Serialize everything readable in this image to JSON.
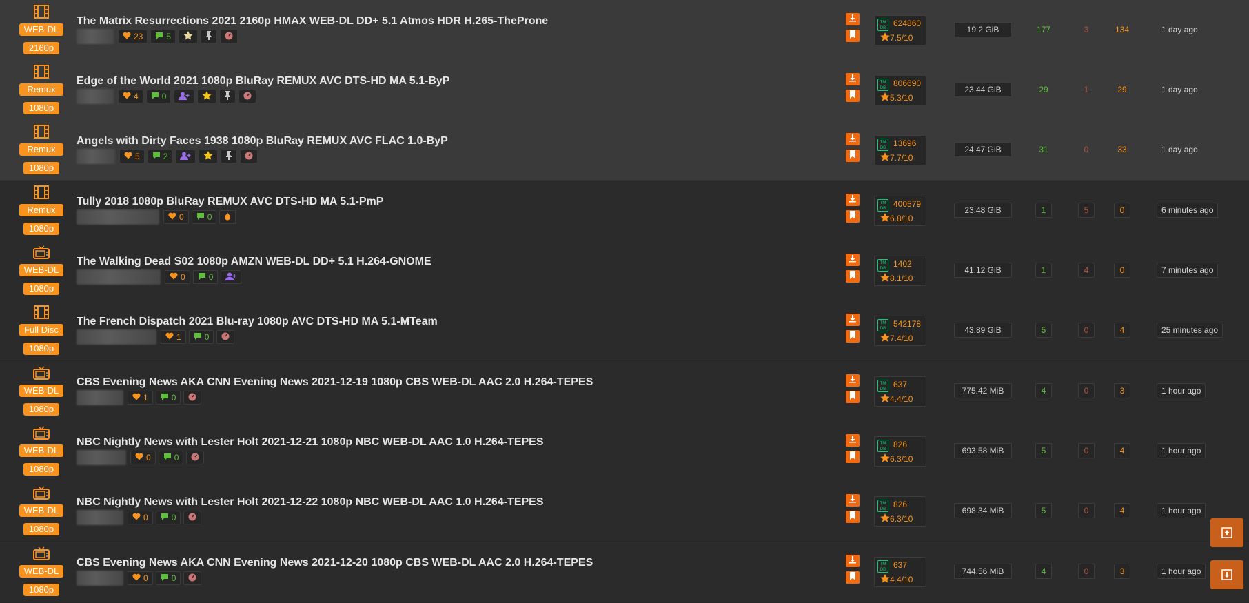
{
  "torrents": [
    {
      "type": "WEB-DL",
      "res": "2160p",
      "cat_icon": "film-icon",
      "title": "The Matrix Resurrections 2021 2160p HMAX WEB-DL DD+ 5.1 Atmos HDR H.265-TheProne",
      "likes": "23",
      "comments": "5",
      "extras": [
        "starw",
        "pin",
        "gauge"
      ],
      "tmdb_votes": "624860",
      "rating": "7.5/10",
      "size": "19.2 GiB",
      "seeders": "177",
      "leechers": "3",
      "completed": "134",
      "age": "1 day ago",
      "pinned": true
    },
    {
      "type": "Remux",
      "res": "1080p",
      "cat_icon": "film-icon",
      "title": "Edge of the World 2021 1080p BluRay REMUX AVC DTS-HD MA 5.1-ByP",
      "likes": "4",
      "comments": "0",
      "extras": [
        "usr",
        "star",
        "pin",
        "gauge"
      ],
      "tmdb_votes": "806690",
      "rating": "5.3/10",
      "size": "23.44 GiB",
      "seeders": "29",
      "leechers": "1",
      "completed": "29",
      "age": "1 day ago",
      "pinned": true
    },
    {
      "type": "Remux",
      "res": "1080p",
      "cat_icon": "film-icon",
      "title": "Angels with Dirty Faces 1938 1080p BluRay REMUX AVC FLAC 1.0-ByP",
      "likes": "5",
      "comments": "2",
      "extras": [
        "usr",
        "star",
        "pin",
        "gauge"
      ],
      "tmdb_votes": "13696",
      "rating": "7.7/10",
      "size": "24.47 GiB",
      "seeders": "31",
      "leechers": "0",
      "completed": "33",
      "age": "1 day ago",
      "pinned": true
    },
    {
      "type": "Remux",
      "res": "1080p",
      "cat_icon": "film-icon",
      "title": "Tully 2018 1080p BluRay REMUX AVC DTS-HD MA 5.1-PmP",
      "likes": "0",
      "comments": "0",
      "extras": [
        "fire"
      ],
      "tmdb_votes": "400579",
      "rating": "6.8/10",
      "size": "23.48 GiB",
      "seeders": "1",
      "leechers": "5",
      "completed": "0",
      "age": "6 minutes ago",
      "pinned": false
    },
    {
      "type": "WEB-DL",
      "res": "1080p",
      "cat_icon": "tv-icon",
      "title": "The Walking Dead S02 1080p AMZN WEB-DL DD+ 5.1 H.264-GNOME",
      "likes": "0",
      "comments": "0",
      "extras": [
        "usr"
      ],
      "tmdb_votes": "1402",
      "rating": "8.1/10",
      "size": "41.12 GiB",
      "seeders": "1",
      "leechers": "4",
      "completed": "0",
      "age": "7 minutes ago",
      "pinned": false
    },
    {
      "type": "Full Disc",
      "res": "1080p",
      "cat_icon": "film-icon",
      "title": "The French Dispatch 2021 Blu-ray 1080p AVC DTS-HD MA 5.1-MTeam",
      "likes": "1",
      "comments": "0",
      "extras": [
        "gauge"
      ],
      "tmdb_votes": "542178",
      "rating": "7.4/10",
      "size": "43.89 GiB",
      "seeders": "5",
      "leechers": "0",
      "completed": "4",
      "age": "25 minutes ago",
      "pinned": false
    },
    {
      "type": "WEB-DL",
      "res": "1080p",
      "cat_icon": "tv-icon",
      "title": "CBS Evening News AKA CNN Evening News 2021-12-19 1080p CBS WEB-DL AAC 2.0 H.264-TEPES",
      "likes": "1",
      "comments": "0",
      "extras": [
        "gauge"
      ],
      "tmdb_votes": "637",
      "rating": "4.4/10",
      "size": "775.42 MiB",
      "seeders": "4",
      "leechers": "0",
      "completed": "3",
      "age": "1 hour ago",
      "pinned": false
    },
    {
      "type": "WEB-DL",
      "res": "1080p",
      "cat_icon": "tv-icon",
      "title": "NBC Nightly News with Lester Holt 2021-12-21 1080p NBC WEB-DL AAC 1.0 H.264-TEPES",
      "likes": "0",
      "comments": "0",
      "extras": [
        "gauge"
      ],
      "tmdb_votes": "826",
      "rating": "6.3/10",
      "size": "693.58 MiB",
      "seeders": "5",
      "leechers": "0",
      "completed": "4",
      "age": "1 hour ago",
      "pinned": false
    },
    {
      "type": "WEB-DL",
      "res": "1080p",
      "cat_icon": "tv-icon",
      "title": "NBC Nightly News with Lester Holt 2021-12-22 1080p NBC WEB-DL AAC 1.0 H.264-TEPES",
      "likes": "0",
      "comments": "0",
      "extras": [
        "gauge"
      ],
      "tmdb_votes": "826",
      "rating": "6.3/10",
      "size": "698.34 MiB",
      "seeders": "5",
      "leechers": "0",
      "completed": "4",
      "age": "1 hour ago",
      "pinned": false
    },
    {
      "type": "WEB-DL",
      "res": "1080p",
      "cat_icon": "tv-icon",
      "title": "CBS Evening News AKA CNN Evening News 2021-12-20 1080p CBS WEB-DL AAC 2.0 H.264-TEPES",
      "likes": "0",
      "comments": "0",
      "extras": [
        "gauge"
      ],
      "tmdb_votes": "637",
      "rating": "4.4/10",
      "size": "744.56 MiB",
      "seeders": "4",
      "leechers": "0",
      "completed": "3",
      "age": "1 hour ago",
      "pinned": false
    }
  ],
  "tmdb_logo_text": "TM DB",
  "colors": {
    "accent": "#f7931e",
    "button": "#f26a10",
    "seed": "#5fbf3c",
    "leech": "#b0543f",
    "tmdb": "#01d277"
  }
}
